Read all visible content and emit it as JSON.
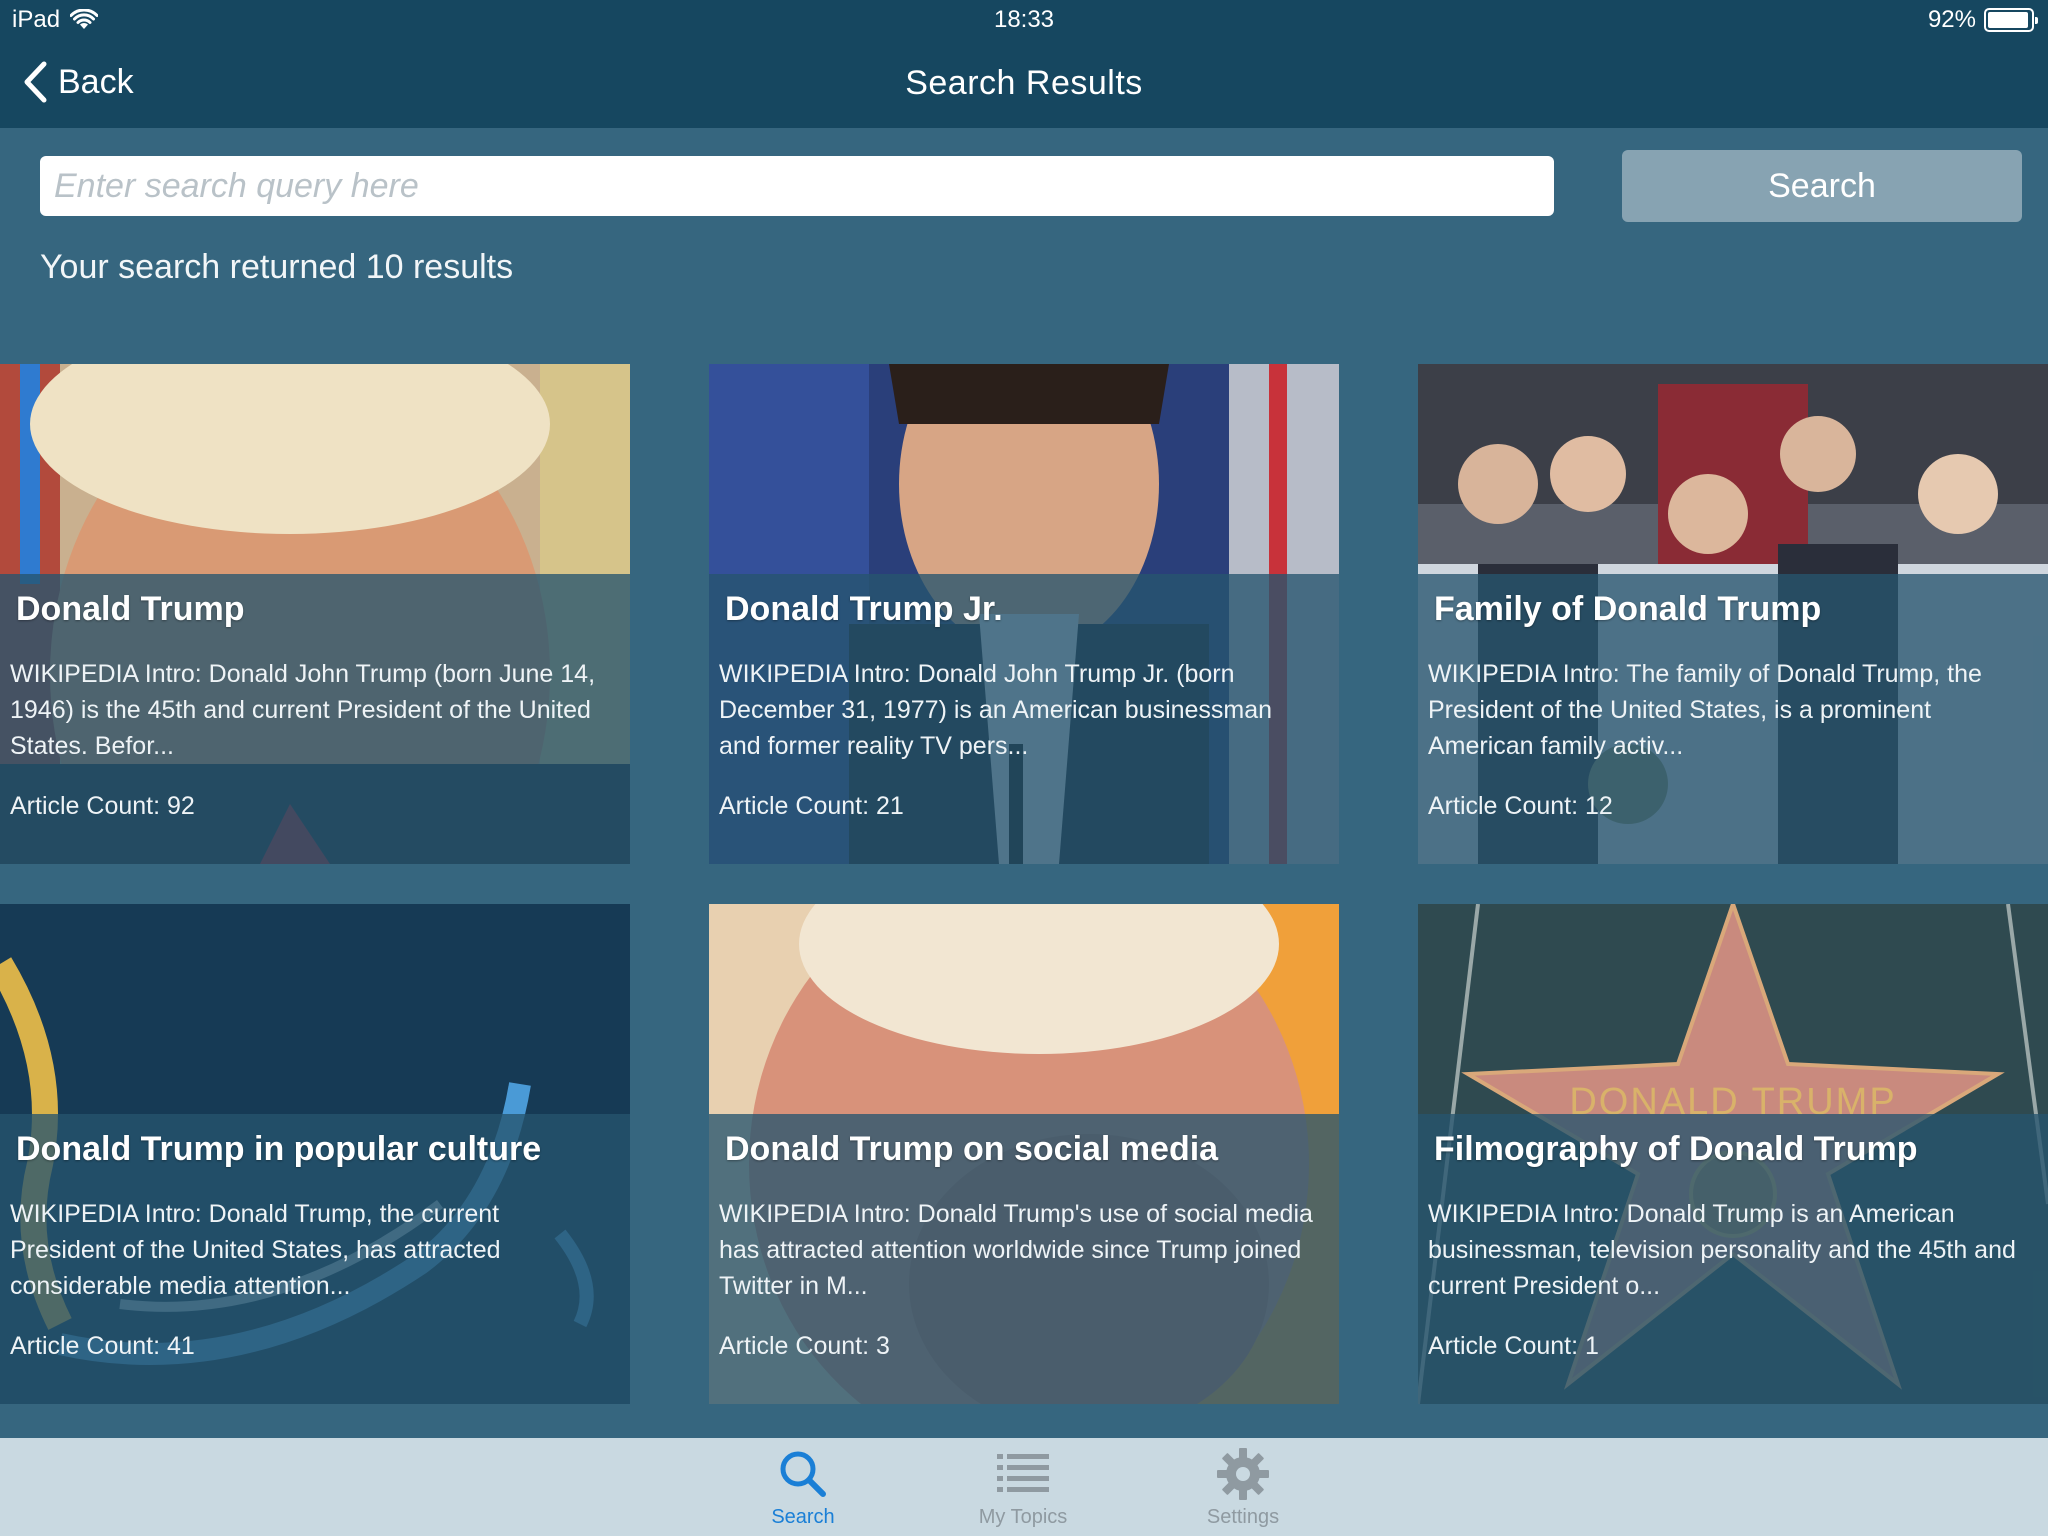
{
  "status_bar": {
    "device": "iPad",
    "time": "18:33",
    "battery": "92%"
  },
  "nav": {
    "back_label": "Back",
    "title": "Search Results"
  },
  "search": {
    "placeholder": "Enter search query here",
    "value": "",
    "button_label": "Search",
    "results_text": "Your search returned 10 results"
  },
  "results": [
    {
      "title": "Donald Trump",
      "intro": "WIKIPEDIA Intro: Donald John Trump (born June 14, 1946) is the 45th and current President of the United States. Befor...",
      "count": "Article Count: 92",
      "image": "portrait-photo"
    },
    {
      "title": "Donald Trump Jr.",
      "intro": "WIKIPEDIA Intro: Donald John Trump Jr. (born December 31, 1977) is an American businessman and former reality TV pers...",
      "count": "Article Count: 21",
      "image": "portrait-photo"
    },
    {
      "title": "Family of Donald Trump",
      "intro": "WIKIPEDIA Intro: The family of Donald Trump, the President of the United States, is a prominent American family activ...",
      "count": "Article Count: 12",
      "image": "group-photo"
    },
    {
      "title": "Donald Trump in popular culture",
      "intro": "WIKIPEDIA Intro: Donald Trump, the current President of the United States, has attracted considerable media attention...",
      "count": "Article Count: 41",
      "image": "abstract-illustration"
    },
    {
      "title": "Donald Trump on social media",
      "intro": "WIKIPEDIA Intro: Donald Trump's use of social media has attracted attention worldwide since Trump joined Twitter in M...",
      "count": "Article Count: 3",
      "image": "portrait-photo"
    },
    {
      "title": "Filmography of Donald Trump",
      "intro": "WIKIPEDIA Intro: Donald Trump is an American businessman, television personality and the 45th and current President o...",
      "count": "Article Count: 1",
      "image": "walk-of-fame-star"
    }
  ],
  "star_text": "DONALD TRUMP",
  "tabbar": {
    "tabs": [
      {
        "label": "Search",
        "icon": "search-icon",
        "active": true
      },
      {
        "label": "My Topics",
        "icon": "list-icon",
        "active": false
      },
      {
        "label": "Settings",
        "icon": "gear-icon",
        "active": false
      }
    ],
    "active_color": "#1a7fd6",
    "inactive_color": "#8f9aa1"
  },
  "colors": {
    "nav_background": "#164760",
    "page_background": "#36667f",
    "search_button": "#87a3b2",
    "tabbar_background": "#c9d9e1"
  }
}
